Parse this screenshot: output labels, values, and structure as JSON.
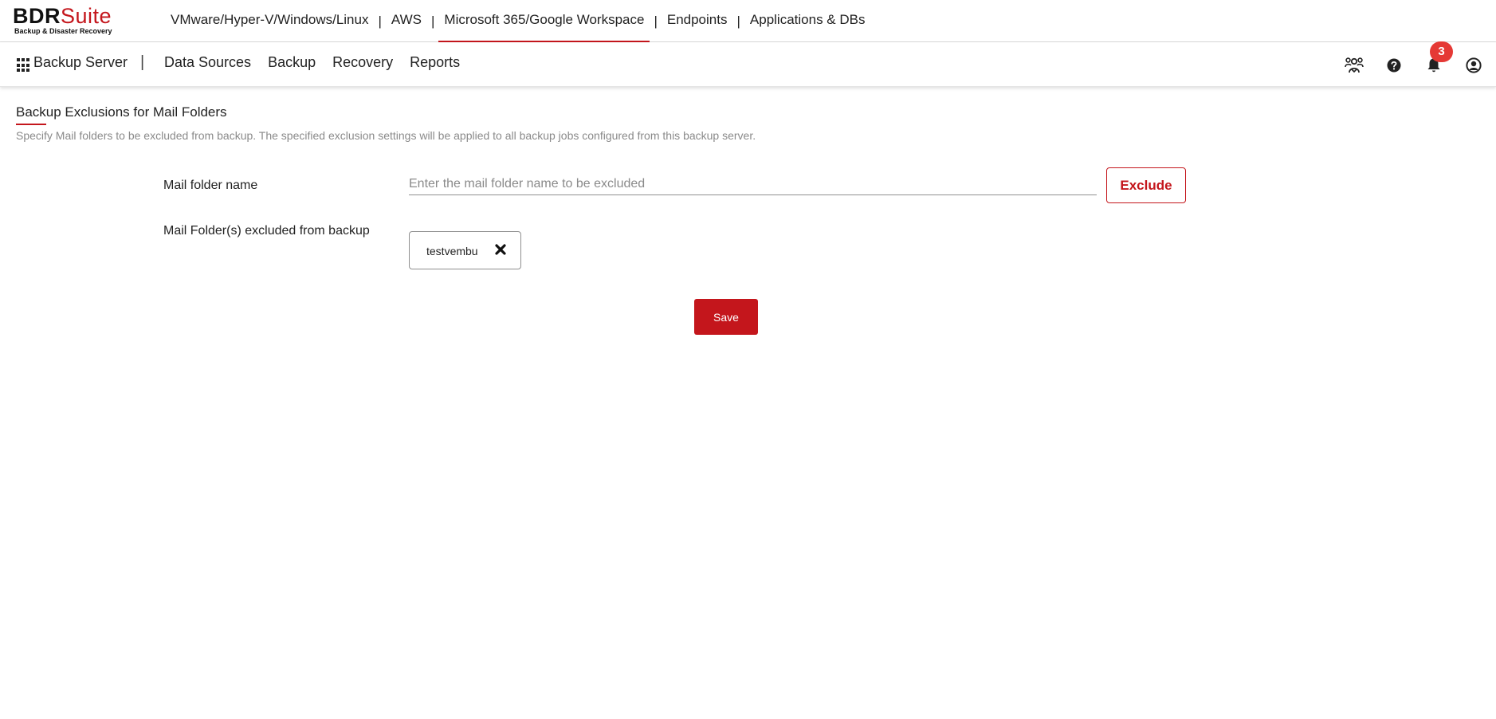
{
  "logo": {
    "main": "BDR",
    "accent": "Suite",
    "subtitle": "Backup & Disaster Recovery"
  },
  "products": [
    {
      "label": "VMware/Hyper-V/Windows/Linux",
      "active": false
    },
    {
      "label": "AWS",
      "active": false
    },
    {
      "label": "Microsoft 365/Google Workspace",
      "active": true
    },
    {
      "label": "Endpoints",
      "active": false
    },
    {
      "label": "Applications & DBs",
      "active": false
    }
  ],
  "product_separator": "|",
  "subnav": {
    "server_label": "Backup Server",
    "divider": "|",
    "links": [
      "Data Sources",
      "Backup",
      "Recovery",
      "Reports"
    ],
    "notification_count": "3",
    "icons": [
      "users-icon",
      "help-icon",
      "bell-icon",
      "user-account-icon"
    ]
  },
  "page": {
    "title": "Backup Exclusions for Mail Folders",
    "description": "Specify Mail folders to be excluded from backup. The specified exclusion settings will be applied to all backup jobs configured from this backup server."
  },
  "form": {
    "folder_name_label": "Mail folder name",
    "folder_name_placeholder": "Enter the mail folder name to be excluded",
    "folder_name_value": "",
    "exclude_button": "Exclude",
    "excluded_label": "Mail Folder(s) excluded from backup",
    "excluded_folders": [
      "testvembu"
    ],
    "save_button": "Save"
  },
  "colors": {
    "accent": "#c4161c",
    "badge": "#e53935"
  }
}
